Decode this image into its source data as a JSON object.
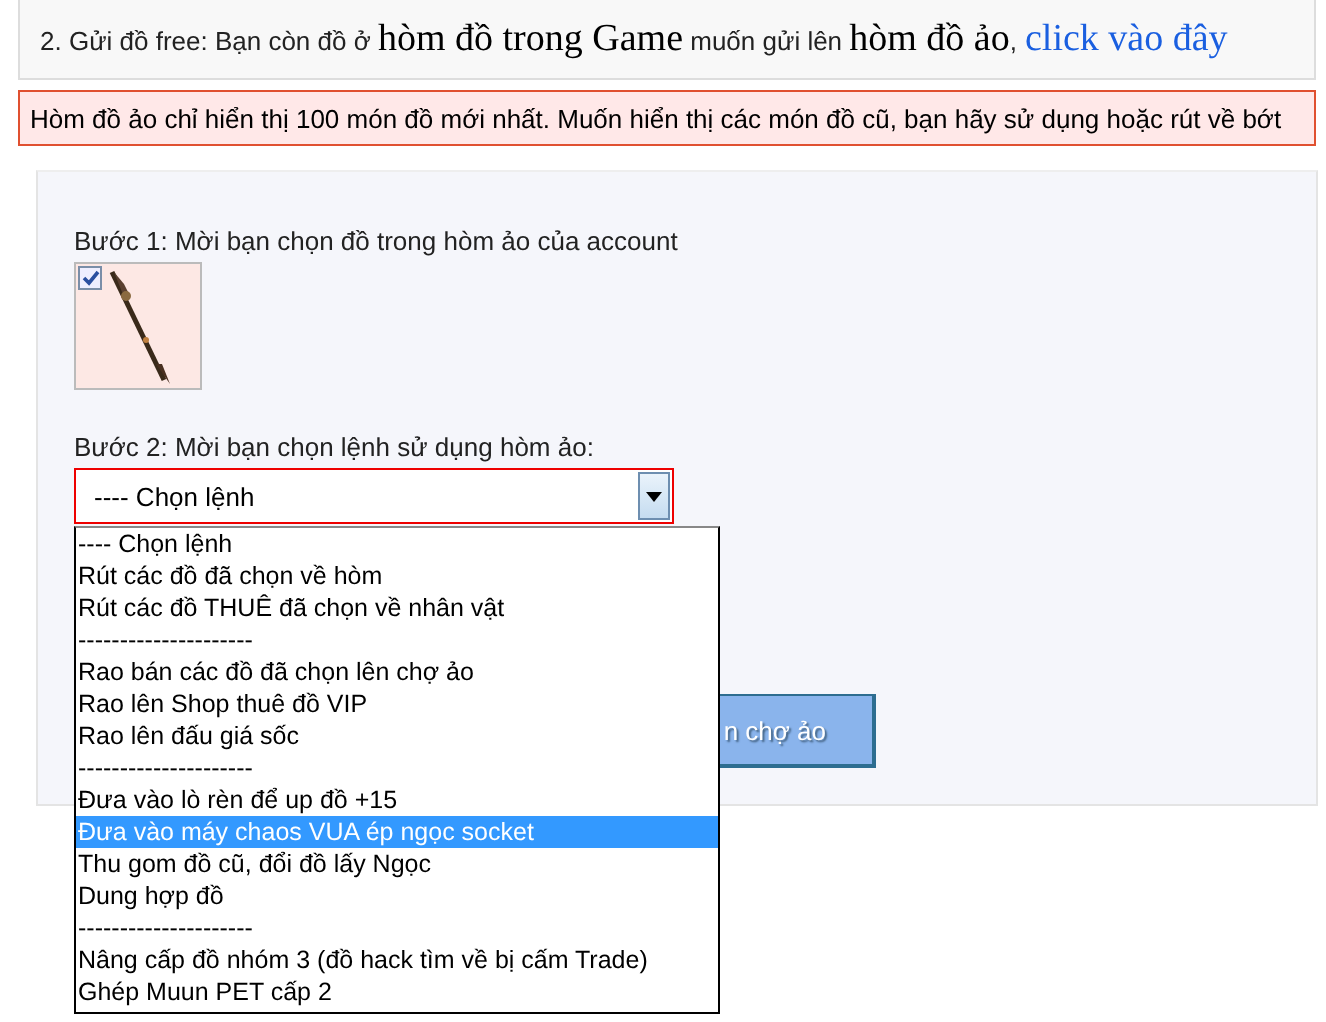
{
  "send_info": {
    "text": "2. Gửi đồ free: Bạn còn đồ ở **hòm đồ trong Game** muốn gửi lên **hòm đồ ảo**,",
    "link": "click vào đây"
  },
  "notice": "Hòm đồ ảo chỉ hiển thị 100 món đồ mới nhất. Muốn hiển thị các món đồ cũ, bạn hãy sử dụng hoặc rút về bớt",
  "step1": {
    "label": "Bước 1: Mời bạn chọn đồ trong hòm ảo của account",
    "items": [
      {
        "checked": true
      }
    ]
  },
  "step2": {
    "label": "Bước 2: Mời bạn chọn lệnh sử dụng hòm ảo:",
    "select_value": "---- Chọn lệnh",
    "expanded": true,
    "options": [
      {
        "label": "---- Chọn lệnh",
        "selected": false
      },
      {
        "label": "Rút các đồ đã chọn về hòm",
        "selected": false
      },
      {
        "label": "Rút các đồ THUÊ đã chọn về nhân vật",
        "selected": false
      },
      {
        "label": "---------------------",
        "selected": false
      },
      {
        "label": "Rao bán các đồ đã chọn lên chợ ảo",
        "selected": false
      },
      {
        "label": "Rao lên Shop thuê đồ VIP",
        "selected": false
      },
      {
        "label": "Rao lên đấu giá sốc",
        "selected": false
      },
      {
        "label": "---------------------",
        "selected": false
      },
      {
        "label": "Đưa vào lò rèn để up đồ +15",
        "selected": false
      },
      {
        "label": "Đưa vào máy chaos VUA ép ngọc socket",
        "selected": true
      },
      {
        "label": "Thu gom đồ cũ, đổi đồ lấy Ngọc",
        "selected": false
      },
      {
        "label": "Dung hợp đồ",
        "selected": false
      },
      {
        "label": "---------------------",
        "selected": false
      },
      {
        "label": "Nâng cấp đồ nhóm 3 (đồ hack tìm về bị cấm Trade)",
        "selected": false
      },
      {
        "label": "Ghép Muun PET cấp 2",
        "selected": false
      }
    ]
  },
  "submit_button": "n chợ ảo"
}
